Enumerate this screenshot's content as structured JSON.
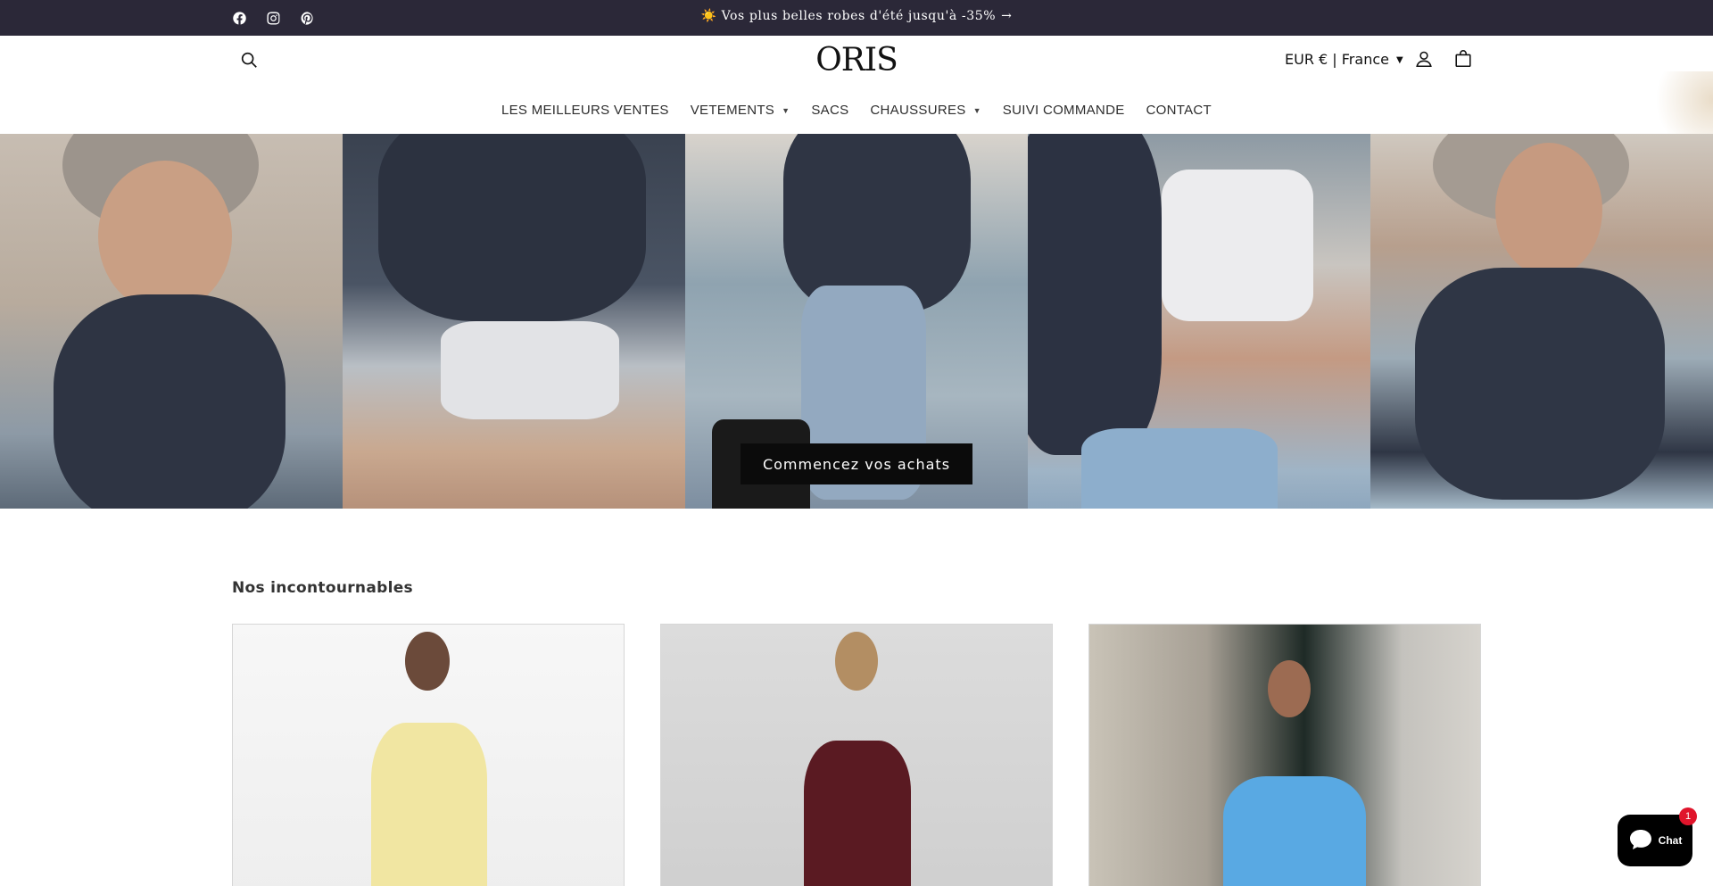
{
  "announcement": {
    "text": "☀️ Vos plus belles robes d'été jusqu'à -35%",
    "arrow": "→"
  },
  "social": [
    {
      "icon": "facebook-icon"
    },
    {
      "icon": "instagram-icon"
    },
    {
      "icon": "pinterest-icon"
    }
  ],
  "header": {
    "logo": "ORIS",
    "locale": "EUR € | France",
    "icons": [
      "search-icon",
      "account-icon",
      "cart-icon"
    ]
  },
  "nav": {
    "items": [
      {
        "label": "LES MEILLEURS VENTES",
        "dropdown": false
      },
      {
        "label": "VETEMENTS",
        "dropdown": true
      },
      {
        "label": "SACS",
        "dropdown": false
      },
      {
        "label": "CHAUSSURES",
        "dropdown": true
      },
      {
        "label": "SUIVI COMMANDE",
        "dropdown": false
      },
      {
        "label": "CONTACT",
        "dropdown": false
      }
    ]
  },
  "hero": {
    "cta_label": "Commencez vos achats"
  },
  "collection": {
    "title": "Nos incontournables",
    "products": [
      {
        "image": "yellow-dress-product-image"
      },
      {
        "image": "burgundy-dress-product-image"
      },
      {
        "image": "blue-dress-product-image"
      }
    ]
  },
  "chat": {
    "label": "Chat",
    "badge": "1"
  },
  "colors": {
    "announcement_bg": "#2b2838",
    "cta_bg": "#0b0b0b",
    "chat_badge": "#e0142b"
  }
}
